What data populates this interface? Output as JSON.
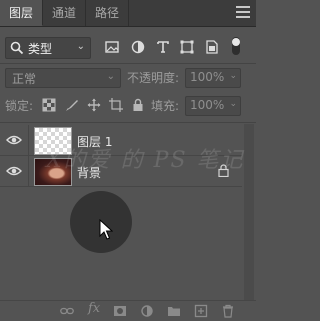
{
  "tabs": [
    {
      "label": "图层",
      "active": true
    },
    {
      "label": "通道",
      "active": false
    },
    {
      "label": "路径",
      "active": false
    }
  ],
  "filter": {
    "kind_label": "类型",
    "icons": [
      "pixel-filter-icon",
      "adjustment-filter-icon",
      "type-filter-icon",
      "shape-filter-icon",
      "smart-object-filter-icon"
    ]
  },
  "blend": {
    "mode": "正常",
    "opacity_label": "不透明度:",
    "opacity_value": "100%"
  },
  "lock": {
    "label": "锁定:",
    "fill_label": "填充:",
    "fill_value": "100%"
  },
  "layers": [
    {
      "name": "图层 1",
      "thumb": "transparent",
      "locked": false
    },
    {
      "name": "背景",
      "thumb": "photo",
      "locked": true
    }
  ],
  "watermark": "X的爱 的 PS 笔记",
  "colors": {
    "panel_bg": "#535353",
    "tab_bar": "#3c3c3c"
  }
}
